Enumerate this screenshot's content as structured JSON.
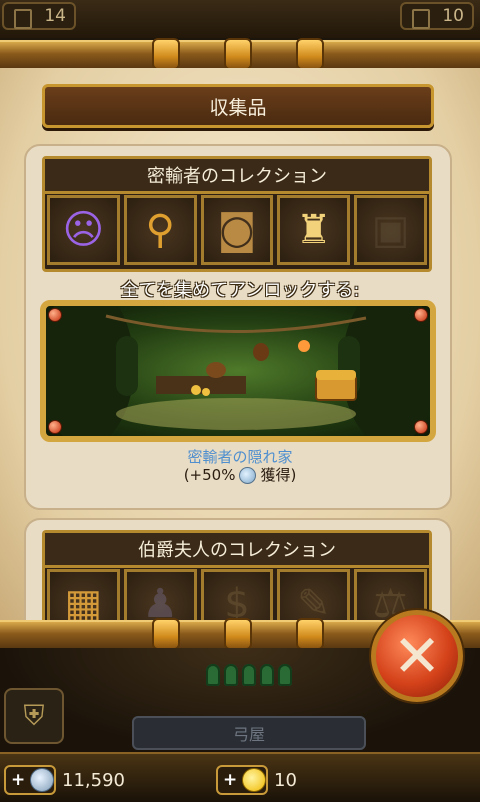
{
  "top_counters": {
    "left": "14",
    "right": "10"
  },
  "window_title": "収集品",
  "smuggler": {
    "title": "密輸者のコレクション",
    "items": [
      {
        "icon": "purple-mask-icon",
        "glyph": "☹",
        "color": "#9b63e6",
        "collected": true
      },
      {
        "icon": "scepter-icon",
        "glyph": "⚲",
        "color": "#e0a030",
        "collected": true
      },
      {
        "icon": "barrel-icon",
        "glyph": "◙",
        "color": "#b98a44",
        "collected": true
      },
      {
        "icon": "lantern-icon",
        "glyph": "♜",
        "color": "#f2d27a",
        "collected": true
      },
      {
        "icon": "treasure-chest-icon",
        "glyph": "▣",
        "color": "#5a4a34",
        "collected": false
      }
    ],
    "unlock_label": "全てを集めてアンロックする:",
    "reward_name": "密輸者の隠れ家",
    "reward_bonus_prefix": "(+50%",
    "reward_bonus_suffix": "獲得)"
  },
  "countess": {
    "title": "伯爵夫人のコレクション",
    "items": [
      {
        "icon": "abacus-icon",
        "glyph": "▦",
        "color": "#d49a3a",
        "collected": true
      },
      {
        "icon": "cloak-icon",
        "glyph": "♟",
        "color": "#6a5f74",
        "collected": false
      },
      {
        "icon": "money-bag-icon",
        "glyph": "$",
        "color": "#6a5534",
        "collected": false
      },
      {
        "icon": "quill-icon",
        "glyph": "✎",
        "color": "#6a5534",
        "collected": false
      },
      {
        "icon": "scales-icon",
        "glyph": "⚖",
        "color": "#6a5534",
        "collected": false
      }
    ]
  },
  "bottom": {
    "building_label": "弓屋"
  },
  "currencies": {
    "silver": "11,590",
    "gold": "10"
  },
  "colors": {
    "frame_gold": "#c8962e",
    "close_red": "#d4421a",
    "reward_blue": "#4f8fcf"
  }
}
